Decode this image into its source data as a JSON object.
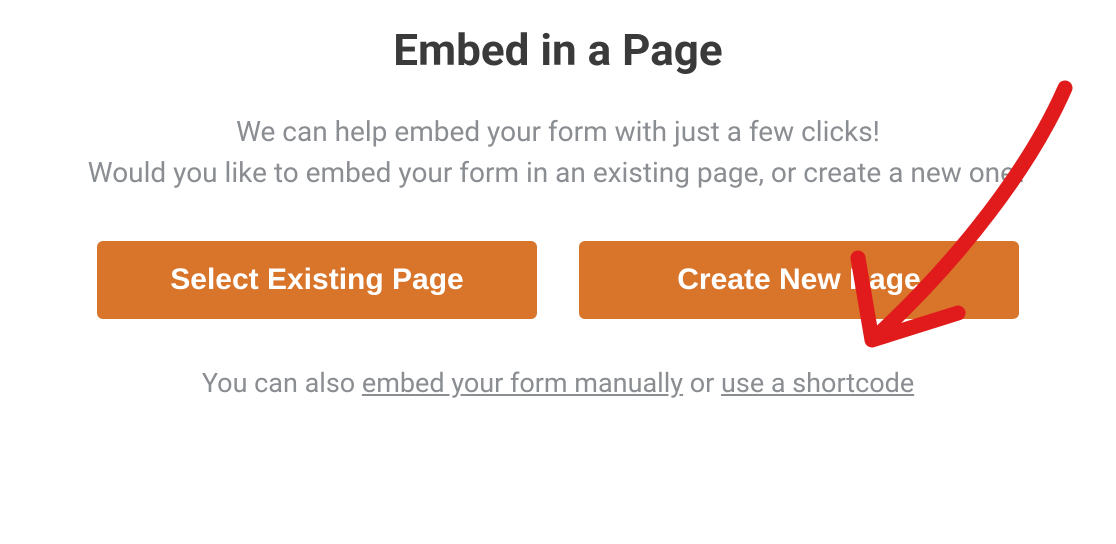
{
  "dialog": {
    "title": "Embed in a Page",
    "description_line1": "We can help embed your form with just a few clicks!",
    "description_line2": "Would you like to embed your form in an existing page, or create a new one?",
    "buttons": {
      "select_existing": "Select Existing Page",
      "create_new": "Create New Page"
    },
    "footer": {
      "prefix": "You can also ",
      "link_manual": "embed your form manually",
      "middle": " or ",
      "link_shortcode": "use a shortcode"
    }
  },
  "annotation": {
    "arrow_color": "#e11b1b",
    "target": "create-new-page-button"
  }
}
